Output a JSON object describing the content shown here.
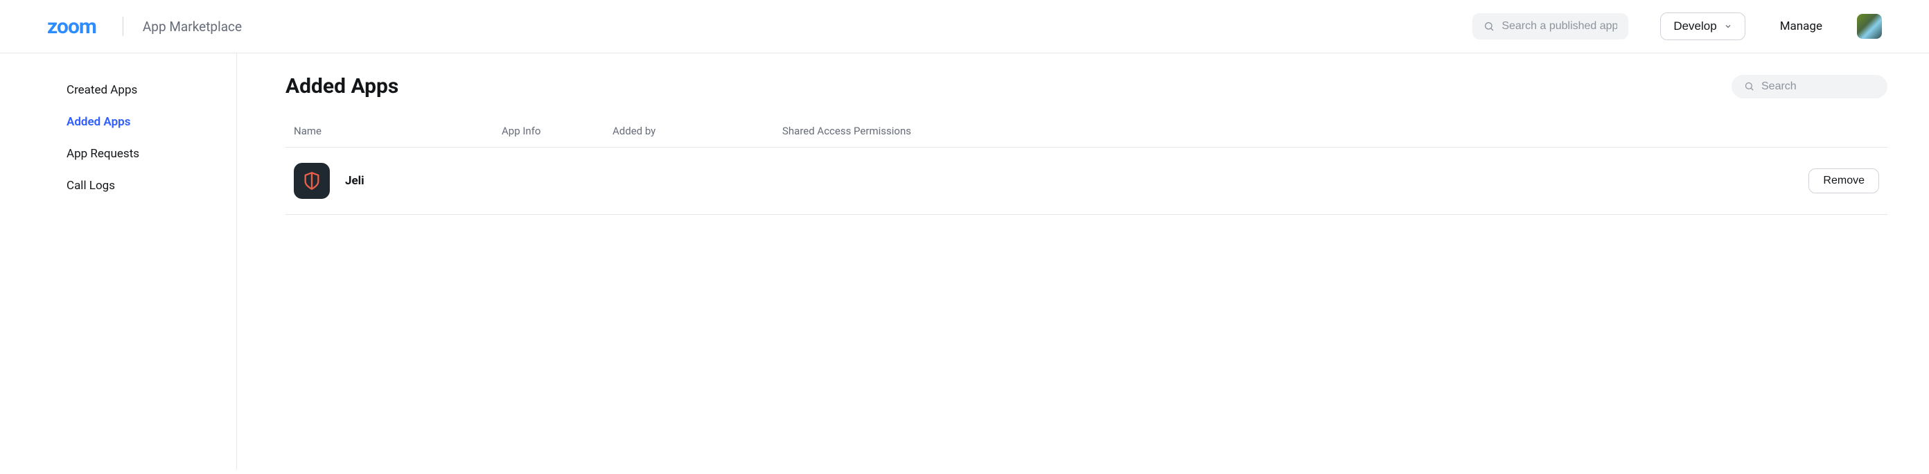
{
  "header": {
    "logo_text": "zoom",
    "marketplace_label": "App Marketplace",
    "search_placeholder": "Search a published app",
    "develop_label": "Develop",
    "manage_label": "Manage"
  },
  "sidebar": {
    "items": [
      {
        "label": "Created Apps",
        "active": false
      },
      {
        "label": "Added Apps",
        "active": true
      },
      {
        "label": "App Requests",
        "active": false
      },
      {
        "label": "Call Logs",
        "active": false
      }
    ]
  },
  "main": {
    "title": "Added Apps",
    "search_placeholder": "Search",
    "columns": {
      "name": "Name",
      "info": "App Info",
      "added_by": "Added by",
      "permissions": "Shared Access Permissions"
    },
    "rows": [
      {
        "name": "Jeli",
        "info": "",
        "added_by": "",
        "permissions": "",
        "action_label": "Remove"
      }
    ]
  }
}
